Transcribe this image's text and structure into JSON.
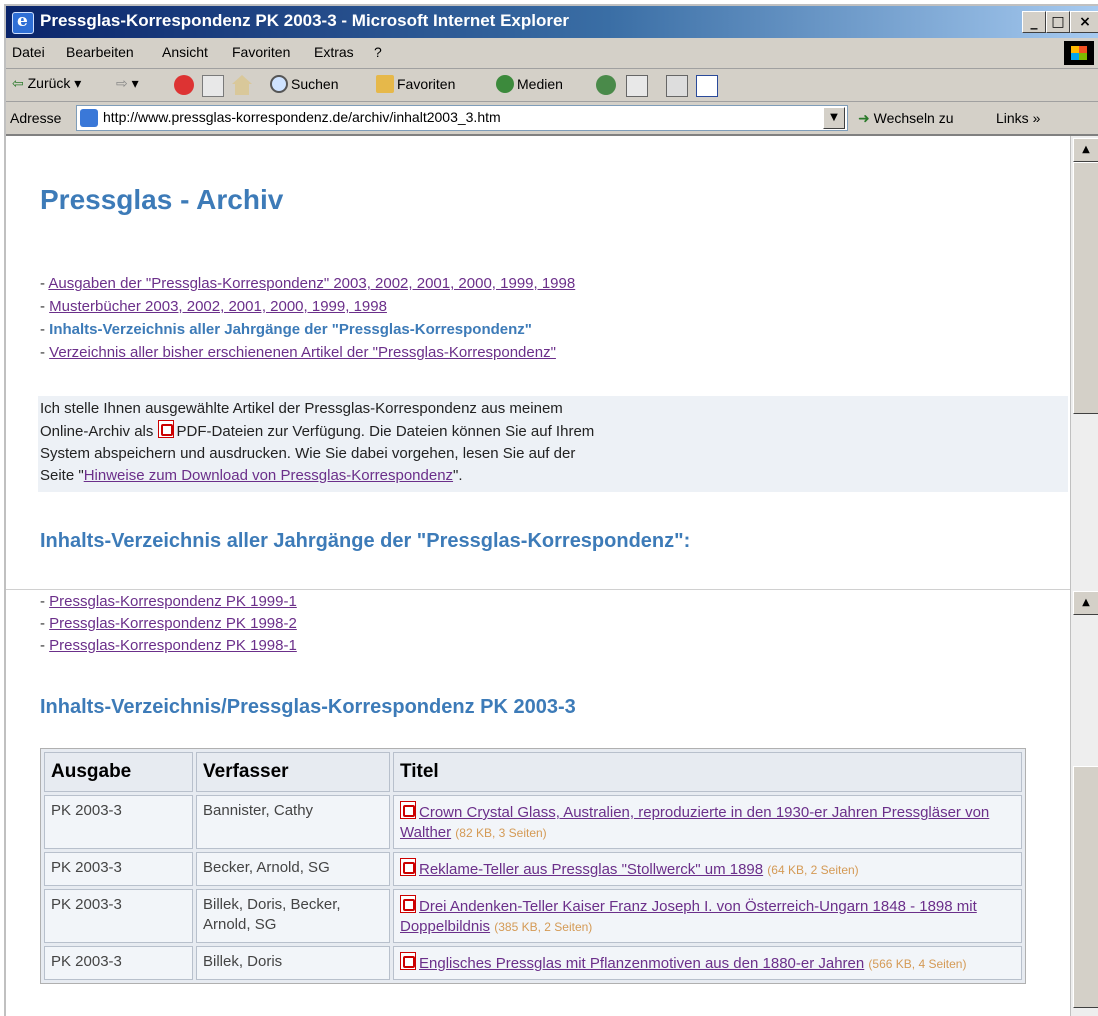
{
  "window": {
    "title": "Pressglas-Korrespondenz PK 2003-3 - Microsoft Internet Explorer"
  },
  "menu": [
    "Datei",
    "Bearbeiten",
    "Ansicht",
    "Favoriten",
    "Extras",
    "?"
  ],
  "toolbar": {
    "back": "Zurück",
    "search": "Suchen",
    "favorites": "Favoriten",
    "media": "Medien"
  },
  "address": {
    "label": "Adresse",
    "url": "http://www.pressglas-korrespondenz.de/archiv/inhalt2003_3.htm",
    "go": "Wechseln zu",
    "links": "Links"
  },
  "page": {
    "heading": "Pressglas - Archiv",
    "top_links": [
      "Ausgaben der \"Pressglas-Korrespondenz\" 2003, 2002, 2001, 2000, 1999, 1998",
      "Musterbücher 2003, 2002, 2001, 2000, 1999, 1998",
      "Inhalts-Verzeichnis aller Jahrgänge der \"Pressglas-Korrespondenz\"",
      "Verzeichnis aller bisher erschienenen Artikel der \"Pressglas-Korrespondenz\""
    ],
    "info": {
      "line1": "Ich stelle Ihnen ausgewählte Artikel der Pressglas-Korrespondenz aus meinem",
      "line2a": "Online-Archiv als",
      "line2b": "PDF-Dateien zur Verfügung. Die Dateien können Sie auf Ihrem",
      "line3": "System abspeichern und ausdrucken. Wie Sie dabei vorgehen, lesen Sie auf der",
      "line4a": "Seite \"",
      "line4_link": "Hinweise zum Download von Pressglas-Korrespondenz",
      "line4b": "\"."
    },
    "section1": {
      "title": "Inhalts-Verzeichnis aller Jahrgänge der \"Pressglas-Korrespondenz\":",
      "links": [
        "Pressglas-Korrespondenz PK 1999-1",
        "Pressglas-Korrespondenz PK 1998-2",
        "Pressglas-Korrespondenz PK 1998-1"
      ]
    },
    "section2": {
      "title": "Inhalts-Verzeichnis/Pressglas-Korrespondenz PK 2003-3"
    },
    "table": {
      "headers": [
        "Ausgabe",
        "Verfasser",
        "Titel"
      ],
      "rows": [
        {
          "issue": "PK 2003-3",
          "author": "Bannister, Cathy",
          "title": "Crown Crystal Glass, Australien, reproduzierte in den 1930-er Jahren Pressgläser von Walther",
          "size": "(82 KB, 3 Seiten)"
        },
        {
          "issue": "PK 2003-3",
          "author": "Becker, Arnold, SG",
          "title": "Reklame-Teller aus Pressglas \"Stollwerck\" um 1898",
          "size": "(64 KB, 2 Seiten)"
        },
        {
          "issue": "PK 2003-3",
          "author": "Billek, Doris, Becker, Arnold, SG",
          "title": "Drei Andenken-Teller Kaiser Franz Joseph I. von Österreich-Ungarn 1848 - 1898 mit Doppelbildnis",
          "size": "(385 KB, 2 Seiten)"
        },
        {
          "issue": "PK 2003-3",
          "author": "Billek, Doris",
          "title": "Englisches Pressglas mit Pflanzenmotiven aus den 1880-er Jahren",
          "size": "(566 KB, 4 Seiten)"
        }
      ]
    }
  }
}
